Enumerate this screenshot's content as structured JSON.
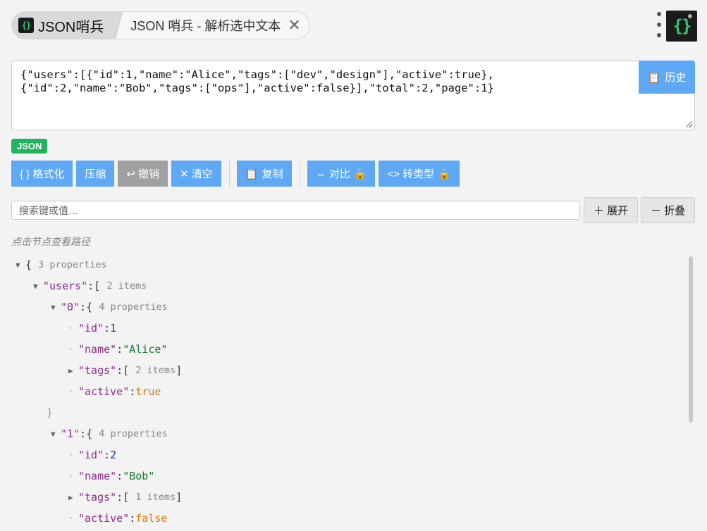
{
  "tabs": {
    "home_title": "JSON哨兵",
    "page_title": "JSON 哨兵 - 解析选中文本",
    "close_glyph": "✕"
  },
  "logo": {
    "small": "{}",
    "large": "{}"
  },
  "input": {
    "line1": "{\"users\":[{\"id\":1,\"name\":\"Alice\",\"tags\":[\"dev\",\"design\"],\"active\":true},",
    "line2": "{\"id\":2,\"name\":\"Bob\",\"tags\":[\"ops\"],\"active\":false}],\"total\":2,\"page\":1}"
  },
  "history_button": {
    "icon": "📋",
    "label": "历史"
  },
  "format_badge": "JSON",
  "toolbar": {
    "format": "{ } 格式化",
    "compress": "压缩",
    "undo": "↩ 撤销",
    "clear": "✕ 清空",
    "copy_icon": "📋",
    "copy": "复制",
    "compare": "⇔ 对比",
    "convert": "<> 转类型",
    "lock_icon": "🔒"
  },
  "search": {
    "placeholder": "搜索键或值…",
    "value": ""
  },
  "expand_button": "＋ 展开",
  "collapse_button": "－ 折叠",
  "hint": "点击节点查看路径",
  "tree": {
    "root_meta": "3 properties",
    "users_key": "\"users\"",
    "users_meta": "2 items",
    "item0_key": "\"0\"",
    "item0_meta": "4 properties",
    "id_key": "\"id\"",
    "id0_value": "1",
    "name_key": "\"name\"",
    "name0_value": "\"Alice\"",
    "tags_key": "\"tags\"",
    "tags0_meta": "2 items",
    "active_key": "\"active\"",
    "active0_value": "true",
    "item1_key": "\"1\"",
    "item1_meta": "4 properties",
    "id1_value": "2",
    "name1_value": "\"Bob\"",
    "tags1_meta": "1 items",
    "active1_value": "false"
  },
  "colors": {
    "accent_blue": "#5ea8f5",
    "badge_green": "#22b35e",
    "undo_gray": "#a0a0a0",
    "key_purple": "#8b2e8b",
    "string_green": "#1a7a2e",
    "bool_orange": "#d77a1a"
  }
}
